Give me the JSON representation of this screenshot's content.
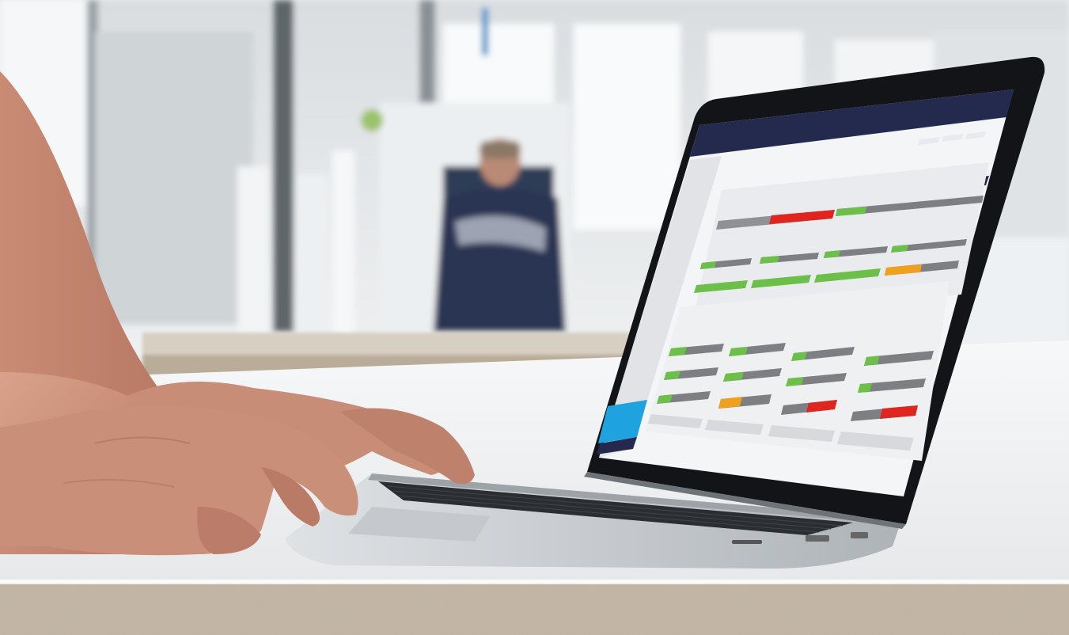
{
  "scene": {
    "description_tags": [
      "laptop-on-desk",
      "hands-typing",
      "factory-background",
      "worker-in-background"
    ],
    "colors": {
      "wall": "#dfe3e6",
      "window": "#f6f8f9",
      "pillar": "#6d7479",
      "worker_shirt": "#2b3552",
      "desk_top": "#f3f4f5",
      "desk_edge": "#b8a892",
      "counter": "#d8cbb6",
      "skin": "#c98f78",
      "skin_shadow": "#a86b58",
      "laptop_body": "#cfd3d7",
      "laptop_bezel": "#111316",
      "keyboard": "#2a2d31"
    }
  },
  "laptop_screen": {
    "header_color": "#232a4e",
    "background": "#f4f5f7",
    "accent_green": "#6cc04a",
    "accent_red": "#e0251f",
    "accent_orange": "#f0a01f",
    "accent_gray": "#7d7f82",
    "accent_blue": "#1ea3e0",
    "sections": {
      "top_counts": [
        "2",
        "2",
        "2",
        "2"
      ],
      "top_bar_levels": [
        0.55,
        0.35
      ],
      "middle_rows": [
        {
          "bars": [
            "green",
            "green",
            "green",
            "green"
          ]
        },
        {
          "bars": [
            "green",
            "green",
            "green",
            "orange"
          ]
        }
      ],
      "bottom_cards": [
        {
          "bars": [
            "green",
            "green",
            "orange"
          ]
        },
        {
          "bars": [
            "green",
            "green",
            "orange"
          ]
        },
        {
          "bars": [
            "green",
            "green",
            "red"
          ]
        },
        {
          "bars": [
            "green",
            "green",
            "red"
          ]
        }
      ]
    }
  }
}
